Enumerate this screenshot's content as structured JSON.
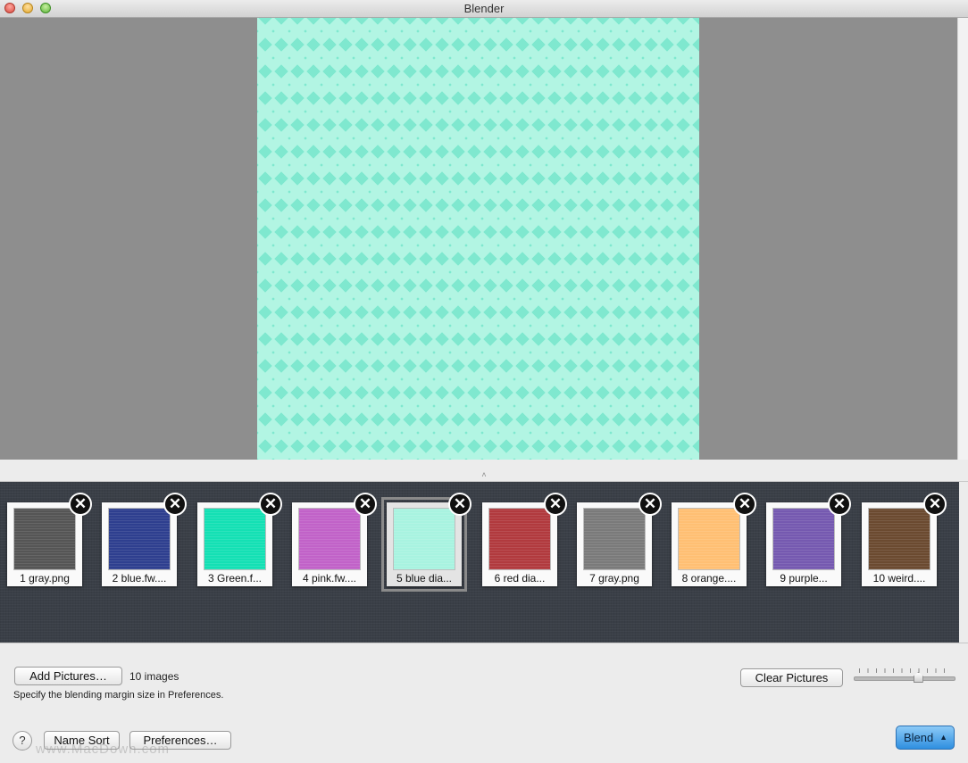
{
  "window": {
    "title": "Blender"
  },
  "thumbnails": [
    {
      "label": "1 gray.png",
      "color": "#555555"
    },
    {
      "label": "2 blue.fw....",
      "color": "#2e3f8f"
    },
    {
      "label": "3 Green.f...",
      "color": "#14e0b4"
    },
    {
      "label": "4 pink.fw....",
      "color": "#c162c8"
    },
    {
      "label": "5 blue dia...",
      "color": "#a8f3e0",
      "selected": true
    },
    {
      "label": "6 red dia...",
      "color": "#b13a3e"
    },
    {
      "label": "7 gray.png",
      "color": "#7a7a7a"
    },
    {
      "label": "8 orange....",
      "color": "#ffbf73"
    },
    {
      "label": "9 purple...",
      "color": "#7559b0"
    },
    {
      "label": "10 weird....",
      "color": "#6b4a30"
    }
  ],
  "remove_glyph": "✕",
  "controls": {
    "add_pictures": "Add Pictures…",
    "image_count": "10 images",
    "hint": "Specify the blending margin size in Preferences.",
    "clear_pictures": "Clear Pictures",
    "name_sort": "Name Sort",
    "preferences": "Preferences…",
    "help": "?",
    "blend": "Blend",
    "blend_arrow": "▲",
    "slider_value": 0.63
  },
  "watermark": "www.MacDown.com",
  "colors": {
    "preview_bg": "#8e8e8e",
    "strip_bg": "#3a3f47",
    "accent_blue": "#2f8fe0"
  }
}
